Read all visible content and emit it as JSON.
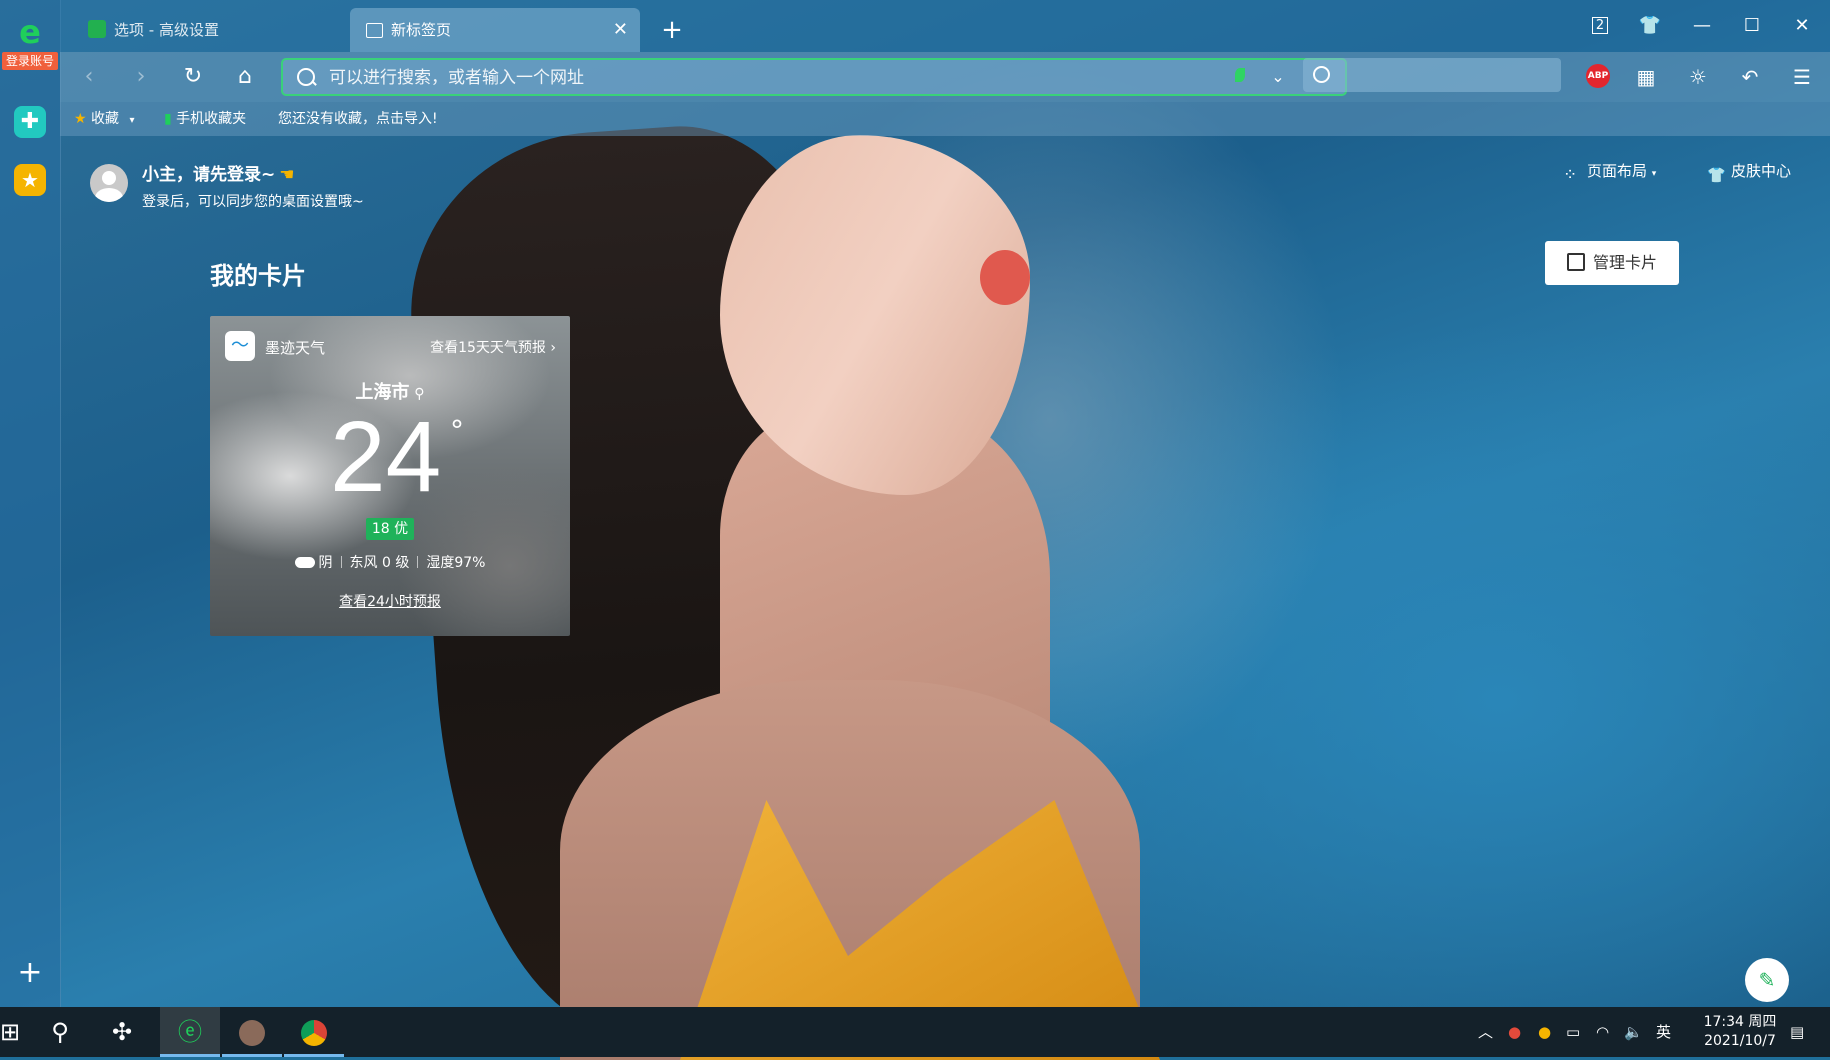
{
  "tabs": [
    {
      "title": "选项 - 高级设置",
      "active": false
    },
    {
      "title": "新标签页",
      "active": true
    }
  ],
  "window": {
    "tab_count": "2"
  },
  "address_bar": {
    "placeholder": "可以进行搜索，或者输入一个网址"
  },
  "sidebar": {
    "login_label": "登录账号"
  },
  "bookmarks": {
    "favorites_label": "收藏",
    "mobile_label": "手机收藏夹",
    "import_hint": "您还没有收藏，点击导入!"
  },
  "user": {
    "greeting": "小主，请先登录~",
    "sub": "登录后，可以同步您的桌面设置哦~"
  },
  "top_actions": {
    "layout": "页面布局",
    "skin": "皮肤中心"
  },
  "cards": {
    "title": "我的卡片",
    "manage": "管理卡片"
  },
  "weather": {
    "provider": "墨迹天气",
    "forecast15": "查看15天天气预报",
    "city": "上海市",
    "temperature": "24",
    "degree": "°",
    "aqi": "18 优",
    "condition": "阴",
    "wind": "东风 0 级",
    "humidity": "湿度97%",
    "forecast24": "查看24小时预报"
  },
  "taskbar": {
    "ime": "英",
    "time": "17:34 周四",
    "date": "2021/10/7"
  },
  "colors": {
    "accent_green": "#3ad17a",
    "abp_red": "#e3262e",
    "aqi_green": "#1fb25a"
  }
}
